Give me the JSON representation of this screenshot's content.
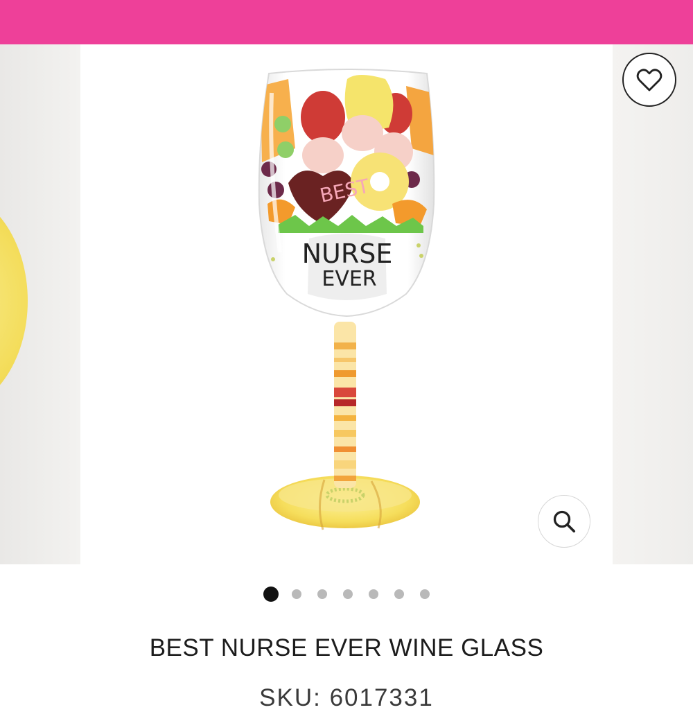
{
  "theme": {
    "accent": "#ee4099",
    "dot_active": "#111111",
    "dot_inactive": "#b9b9b9"
  },
  "gallery": {
    "slide_count": 7,
    "active_index": 0,
    "image_text": {
      "line1": "BEST",
      "line2": "NURSE",
      "line3": "EVER"
    },
    "wishlist_icon": "heart-icon",
    "zoom_icon": "search-icon"
  },
  "product": {
    "title": "BEST NURSE EVER WINE GLASS",
    "sku": "SKU: 6017331"
  }
}
